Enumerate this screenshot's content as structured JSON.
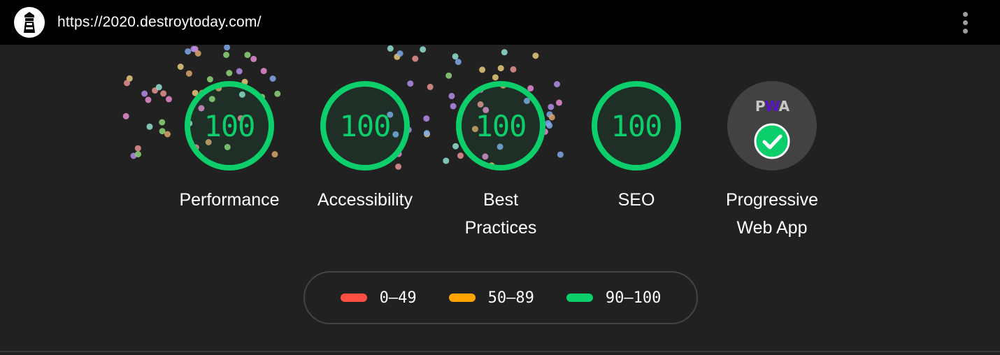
{
  "browser": {
    "url": "https://2020.destroytoday.com/",
    "logo_icon": "lighthouse-icon",
    "menu_icon": "more-vertical-icon"
  },
  "gauges": [
    {
      "score": "100",
      "label": "Performance"
    },
    {
      "score": "100",
      "label": "Accessibility"
    },
    {
      "score": "100",
      "label_line1": "Best",
      "label_line2": "Practices"
    },
    {
      "score": "100",
      "label": "SEO"
    }
  ],
  "pwa": {
    "badge_p": "P",
    "badge_w": "W",
    "badge_a": "A",
    "label_line1": "Progressive",
    "label_line2": "Web App",
    "status_icon": "check-circle-icon"
  },
  "legend": [
    {
      "range": "0–49",
      "color": "#ff4e42"
    },
    {
      "range": "50–89",
      "color": "#ffa400"
    },
    {
      "range": "90–100",
      "color": "#0cce6b"
    }
  ],
  "colors": {
    "pass": "#0cce6b",
    "background": "#212121",
    "topbar": "#000000"
  }
}
